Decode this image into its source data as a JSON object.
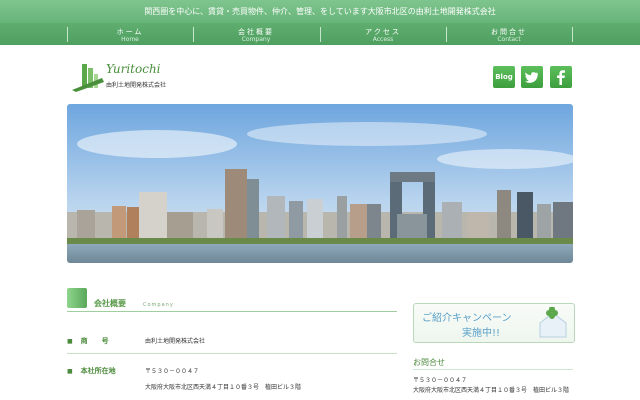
{
  "topbar": {
    "text": "関西圏を中心に、賃貸・売買物件、仲介、管理、をしています大阪市北区の由利土地開発株式会社"
  },
  "nav": [
    {
      "jp": "ホーム",
      "en": "Home"
    },
    {
      "jp": "会社概要",
      "en": "Company"
    },
    {
      "jp": "アクセス",
      "en": "Access"
    },
    {
      "jp": "お問合せ",
      "en": "Contact"
    }
  ],
  "logo": {
    "script": "Yuritochi",
    "corp": "由利土地開発株式会社"
  },
  "social": {
    "blog": "Blog",
    "twitter": "twitter-icon",
    "facebook": "facebook-icon"
  },
  "colors": {
    "green": "#5fae6f",
    "sky": "#7fb4e4"
  },
  "company_section": {
    "title": "会社概要",
    "en": "Company",
    "rows": [
      {
        "label": "商　　号",
        "lines": [
          "由利土地開発株式会社"
        ]
      },
      {
        "label": "本社所在地",
        "lines": [
          "〒５３０－００４７",
          "大阪府大阪市北区西天満４丁目１０番３号　植田ビル３階"
        ]
      }
    ]
  },
  "sidebar": {
    "banner": {
      "line1": "ご紹介キャンペーン",
      "line2": "実施中!!"
    },
    "contact_title": "お問合せ",
    "postal": "〒５３０－００４７",
    "address": "大阪府大阪市北区西天満４丁目１０番３号　植田ビル３階"
  }
}
